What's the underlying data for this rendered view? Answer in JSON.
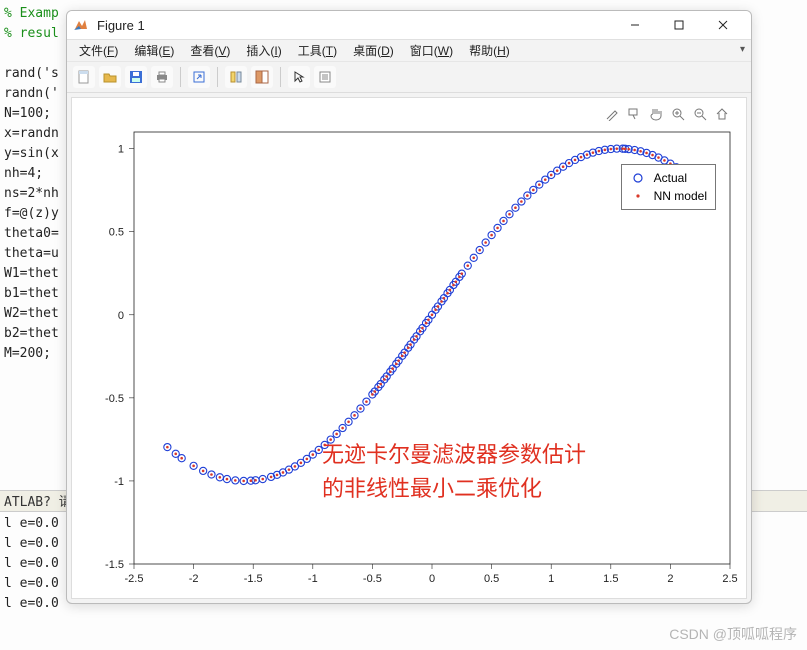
{
  "editor": {
    "lines": [
      {
        "cls": "comment",
        "text": "% Examp"
      },
      {
        "cls": "comment",
        "text": "% resul"
      },
      {
        "cls": "",
        "text": ""
      },
      {
        "cls": "",
        "text": "rand('s"
      },
      {
        "cls": "",
        "text": "randn('"
      },
      {
        "cls": "",
        "text": "N=100;"
      },
      {
        "cls": "",
        "text": "x=randn"
      },
      {
        "cls": "",
        "text": "y=sin(x"
      },
      {
        "cls": "",
        "text": "nh=4;"
      },
      {
        "cls": "",
        "text": "ns=2*nh"
      },
      {
        "cls": "",
        "text": "f=@(z)y"
      },
      {
        "cls": "",
        "text": "theta0="
      },
      {
        "cls": "",
        "text": "theta=u"
      },
      {
        "cls": "",
        "text": "W1=thet"
      },
      {
        "cls": "",
        "text": "b1=thet"
      },
      {
        "cls": "",
        "text": "W2=thet"
      },
      {
        "cls": "",
        "text": "b2=thet"
      },
      {
        "cls": "",
        "text": "M=200;"
      }
    ],
    "prompt_bar": "ATLAB? 请",
    "out_lines": [
      "l e=0.0",
      "l e=0.0",
      "l e=0.0",
      "l e=0.0",
      "l e=0.0"
    ]
  },
  "figure": {
    "title": "Figure 1",
    "menu": [
      {
        "label": "文件",
        "ul": "F"
      },
      {
        "label": "编辑",
        "ul": "E"
      },
      {
        "label": "查看",
        "ul": "V"
      },
      {
        "label": "插入",
        "ul": "I"
      },
      {
        "label": "工具",
        "ul": "T"
      },
      {
        "label": "桌面",
        "ul": "D"
      },
      {
        "label": "窗口",
        "ul": "W"
      },
      {
        "label": "帮助",
        "ul": "H"
      }
    ],
    "toolbar_icons": [
      "new",
      "open",
      "save",
      "print",
      "|",
      "link",
      "|",
      "rotate",
      "datacursor",
      "|",
      "arrow",
      "insert"
    ],
    "fig_icons": [
      "brush",
      "datatip",
      "pan",
      "zoom-in",
      "zoom-out",
      "home"
    ],
    "legend": {
      "actual": "Actual",
      "nn": "NN model"
    },
    "overlay": {
      "line1": "无迹卡尔曼滤波器参数估计",
      "line2": "的非线性最小二乘优化"
    },
    "axes": {
      "xticks": [
        -2.5,
        -2,
        -1.5,
        -1,
        -0.5,
        0,
        0.5,
        1,
        1.5,
        2,
        2.5
      ],
      "yticks": [
        -1.5,
        -1,
        -0.5,
        0,
        0.5,
        1
      ],
      "xlim": [
        -2.5,
        2.5
      ],
      "ylim": [
        -1.5,
        1.1
      ]
    }
  },
  "chart_data": {
    "type": "scatter",
    "xlabel": "",
    "ylabel": "",
    "xlim": [
      -2.5,
      2.5
    ],
    "ylim": [
      -1.5,
      1.1
    ],
    "series": [
      {
        "name": "Actual",
        "marker": "open-circle",
        "color": "#1f3fd6"
      },
      {
        "name": "NN model",
        "marker": "dot",
        "color": "#d93a2b"
      }
    ],
    "x": [
      -2.22,
      -2.15,
      -2.1,
      -2.0,
      -1.92,
      -1.85,
      -1.78,
      -1.72,
      -1.65,
      -1.58,
      -1.52,
      -1.48,
      -1.42,
      -1.35,
      -1.3,
      -1.25,
      -1.2,
      -1.15,
      -1.1,
      -1.05,
      -1.0,
      -0.95,
      -0.9,
      -0.85,
      -0.8,
      -0.75,
      -0.7,
      -0.65,
      -0.6,
      -0.55,
      -0.5,
      -0.45,
      -0.4,
      -0.35,
      -0.3,
      -0.25,
      -0.2,
      -0.15,
      -0.1,
      -0.05,
      0.0,
      0.05,
      0.1,
      0.15,
      0.2,
      0.25,
      0.3,
      0.35,
      0.4,
      0.45,
      0.5,
      0.55,
      0.6,
      0.65,
      0.7,
      0.75,
      0.8,
      0.85,
      0.9,
      0.95,
      1.0,
      1.05,
      1.1,
      1.15,
      1.2,
      1.25,
      1.3,
      1.35,
      1.4,
      1.45,
      1.5,
      1.55,
      1.6,
      1.62,
      1.65,
      1.7,
      1.75,
      1.8,
      1.85,
      1.9,
      1.95,
      2.0,
      2.05,
      2.1,
      2.12,
      -0.48,
      -0.43,
      -0.38,
      -0.33,
      -0.28,
      -0.23,
      -0.18,
      -0.13,
      -0.08,
      -0.03,
      0.03,
      0.08,
      0.13,
      0.18,
      0.23
    ],
    "y_actual": "sin(x)",
    "y_nn": "sin(x)+noise≈0"
  },
  "watermark": "CSDN @顶呱呱程序"
}
